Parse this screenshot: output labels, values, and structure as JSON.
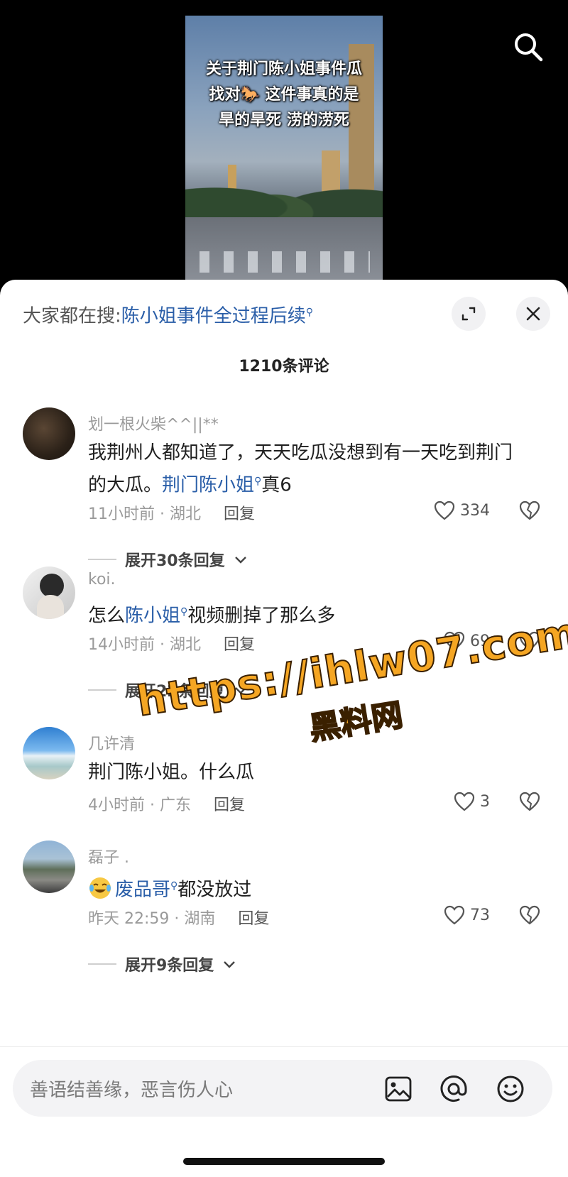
{
  "video": {
    "caption_lines": [
      "关于荆门陈小姐事件瓜",
      "找对🐎 这件事真的是",
      "旱的旱死 涝的涝死"
    ]
  },
  "search_bar": {
    "prefix": "大家都在搜:",
    "query": "陈小姐事件全过程后续"
  },
  "comment_count": "1210条评论",
  "comments": [
    {
      "name": "划一根火柴^^||**",
      "text_parts": [
        "我荆州人都知道了，天天吃瓜没想到有一天吃到荆门的大瓜。",
        "荆门陈小姐",
        "真6"
      ],
      "meta": "11小时前 · 湖北",
      "reply_label": "回复",
      "likes": "334",
      "expand": "展开30条回复"
    },
    {
      "name": "koi.",
      "text_parts": [
        "怎么",
        "陈小姐",
        "视频删掉了那么多"
      ],
      "meta": "14小时前 · 湖北",
      "reply_label": "回复",
      "likes": "69",
      "expand": "展开22条回复"
    },
    {
      "name": "几许清",
      "text_parts": [
        "荆门陈小姐。什么瓜"
      ],
      "meta": "4小时前 · 广东",
      "reply_label": "回复",
      "likes": "3"
    },
    {
      "name": "磊子 .",
      "text_parts": [
        "废品哥",
        "都没放过"
      ],
      "meta": "昨天 22:59 · 湖南",
      "reply_label": "回复",
      "likes": "73",
      "expand": "展开9条回复"
    }
  ],
  "watermark": {
    "url": "https://ihlw07.com",
    "name": "黑料网"
  },
  "input": {
    "placeholder": "善语结善缘，恶言伤人心"
  },
  "colors": {
    "link": "#2a5ea8",
    "watermark": "#f5a623"
  },
  "icons": [
    "search-icon",
    "expand-icon",
    "close-icon",
    "heart-icon",
    "broken-heart-icon",
    "chevron-down-icon",
    "image-icon",
    "at-icon",
    "emoji-icon",
    "search-tag-icon"
  ]
}
